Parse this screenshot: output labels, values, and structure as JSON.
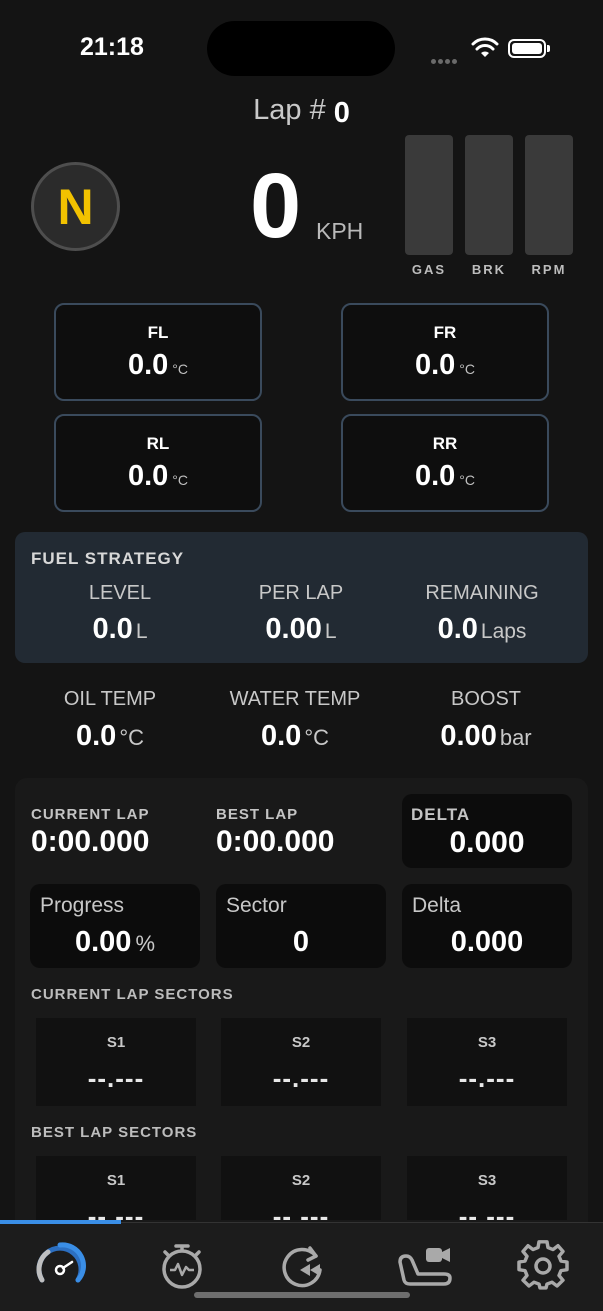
{
  "status_bar": {
    "time": "21:18"
  },
  "lap": {
    "label": "Lap #",
    "value": "0"
  },
  "gear": "N",
  "speed": {
    "value": "0",
    "unit": "KPH"
  },
  "bars": [
    {
      "label": "GAS",
      "level": 0
    },
    {
      "label": "BRK",
      "level": 0
    },
    {
      "label": "RPM",
      "level": 0
    }
  ],
  "tyres": [
    {
      "name": "FL",
      "value": "0.0",
      "unit": "°C"
    },
    {
      "name": "FR",
      "value": "0.0",
      "unit": "°C"
    },
    {
      "name": "RL",
      "value": "0.0",
      "unit": "°C"
    },
    {
      "name": "RR",
      "value": "0.0",
      "unit": "°C"
    }
  ],
  "fuel": {
    "title": "FUEL STRATEGY",
    "items": [
      {
        "label": "LEVEL",
        "value": "0.0",
        "unit": "L"
      },
      {
        "label": "PER LAP",
        "value": "0.00",
        "unit": "L"
      },
      {
        "label": "REMAINING",
        "value": "0.0",
        "unit": "Laps"
      }
    ]
  },
  "engine": [
    {
      "label": "OIL TEMP",
      "value": "0.0",
      "unit": "°C"
    },
    {
      "label": "WATER TEMP",
      "value": "0.0",
      "unit": "°C"
    },
    {
      "label": "BOOST",
      "value": "0.00",
      "unit": "bar"
    }
  ],
  "timing": {
    "current_lap_label": "CURRENT LAP",
    "current_lap": "0:00.000",
    "best_lap_label": "BEST LAP",
    "best_lap": "0:00.000",
    "delta_label": "DELTA",
    "delta": "0.000"
  },
  "cards": [
    {
      "label": "Progress",
      "value": "0.00",
      "unit": "%"
    },
    {
      "label": "Sector",
      "value": "0",
      "unit": ""
    },
    {
      "label": "Delta",
      "value": "0.000",
      "unit": ""
    }
  ],
  "current_sectors": {
    "title": "CURRENT LAP SECTORS",
    "items": [
      {
        "name": "S1",
        "value": "--.---"
      },
      {
        "name": "S2",
        "value": "--.---"
      },
      {
        "name": "S3",
        "value": "--.---"
      }
    ]
  },
  "best_sectors": {
    "title": "BEST LAP SECTORS",
    "items": [
      {
        "name": "S1",
        "value": "--.---"
      },
      {
        "name": "S2",
        "value": "--.---"
      },
      {
        "name": "S3",
        "value": "--.---"
      }
    ]
  },
  "tabs": [
    {
      "icon": "speedometer-icon",
      "active": true
    },
    {
      "icon": "stopwatch-icon",
      "active": false
    },
    {
      "icon": "replay-icon",
      "active": false
    },
    {
      "icon": "seat-camera-icon",
      "active": false
    },
    {
      "icon": "gear-icon",
      "active": false
    }
  ],
  "colors": {
    "accent": "#3a8ee6",
    "gear": "#f2c200",
    "panel": "#222a33"
  }
}
